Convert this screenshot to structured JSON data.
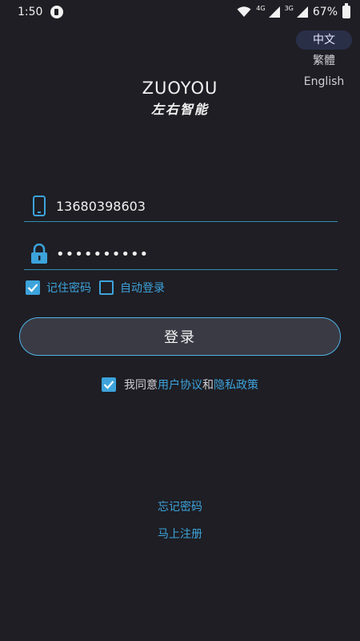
{
  "status_bar": {
    "time": "1:50",
    "signal_1_label": "4G",
    "signal_2_label": "3G",
    "battery_percent": "67%"
  },
  "languages": [
    {
      "label": "中文",
      "active": true
    },
    {
      "label": "繁體",
      "active": false
    },
    {
      "label": "English",
      "active": false
    }
  ],
  "logo": {
    "english": "ZUOYOU",
    "chinese": "左右智能"
  },
  "form": {
    "phone_value": "13680398603",
    "password_value": "••••••••••",
    "remember_password_label": "记住密码",
    "remember_password_checked": true,
    "auto_login_label": "自动登录",
    "auto_login_checked": false
  },
  "login_button_label": "登录",
  "agreement": {
    "checked": true,
    "prefix": "我同意",
    "user_agreement": "用户协议",
    "conjunction": "和",
    "privacy_policy": "隐私政策"
  },
  "links": {
    "forgot_password": "忘记密码",
    "register_now": "马上注册"
  },
  "colors": {
    "background": "#1e1e24",
    "accent": "#3da3db",
    "button_fill": "#3a3a44",
    "active_language": "#2a2f48"
  }
}
